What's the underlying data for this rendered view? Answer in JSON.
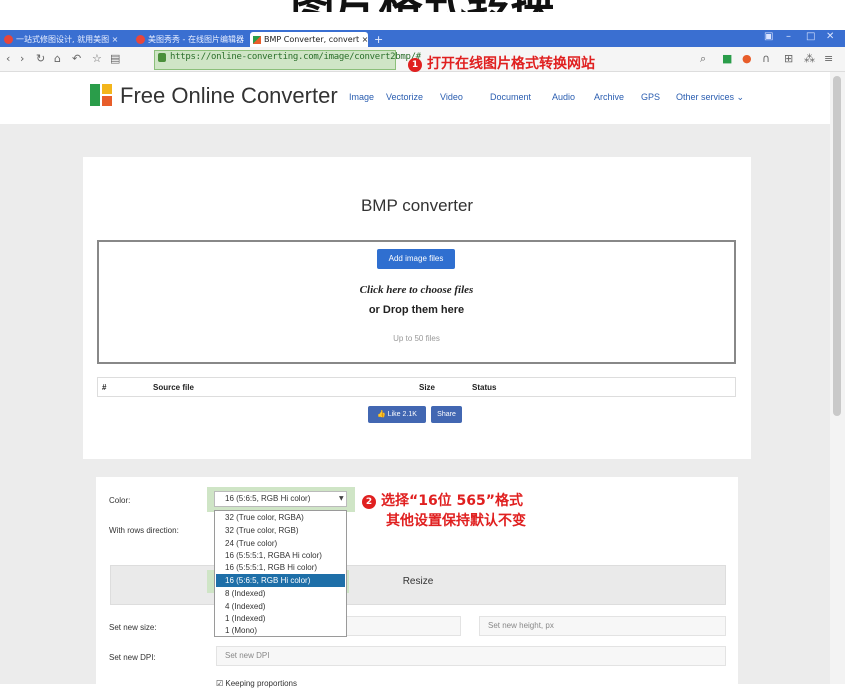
{
  "banner": {
    "title": "图片格式转换"
  },
  "browser": {
    "tabs": [
      {
        "label": "一站式修图设计, 就用美图 ×"
      },
      {
        "label": "美图秀秀 - 在线图片编辑器 ×"
      },
      {
        "label": "BMP Converter, convert ×"
      }
    ],
    "new_tab": "+",
    "url": "https://online-converting.com/image/convert2bmp/#"
  },
  "annotations": {
    "step1_number": "1",
    "step1_text": "打开在线图片格式转换网站",
    "step2_number": "2",
    "step2_line1": "选择“16位 565”格式",
    "step2_line2": "其他设置保持默认不变"
  },
  "site": {
    "name": "Free Online Converter",
    "nav": [
      "Image",
      "Vectorize",
      "Video",
      "Document",
      "Audio",
      "Archive",
      "GPS",
      "Other services ⌄"
    ]
  },
  "converter": {
    "title": "BMP converter",
    "add_button": "Add image files",
    "click_here": "Click here to choose files",
    "drop_here": "or Drop them here",
    "limit": "Up to 50 files",
    "table_headers": [
      "#",
      "Source file",
      "Size",
      "Status"
    ],
    "like_label": "👍 Like 2.1K",
    "share_label": "Share"
  },
  "options": {
    "color_label": "Color:",
    "rows_label": "With rows direction:",
    "selected_value": "16 (5:6:5, RGB Hi color)",
    "dropdown_options": [
      "32 (True color, RGBA)",
      "32 (True color, RGB)",
      "24 (True color)",
      "16 (5:5:5:1, RGBA Hi color)",
      "16 (5:5:5:1, RGB Hi color)",
      "16 (5:6:5, RGB Hi color)",
      "8 (Indexed)",
      "4 (Indexed)",
      "1 (Indexed)",
      "1 (Mono)"
    ],
    "resize_label": "Resize",
    "new_size_label": "Set new size:",
    "new_height_placeholder": "Set new height, px",
    "new_dpi_label": "Set new DPI:",
    "new_dpi_placeholder": "Set new DPI",
    "keep_proportions": "☑ Keeping proportions"
  },
  "colors": {
    "tabbar": "#3a6fd1",
    "highlight_green": "#cfe5c6",
    "annotation_red": "#e02020",
    "button_blue": "#2f6fd0",
    "selected_option": "#1e6fa8"
  }
}
